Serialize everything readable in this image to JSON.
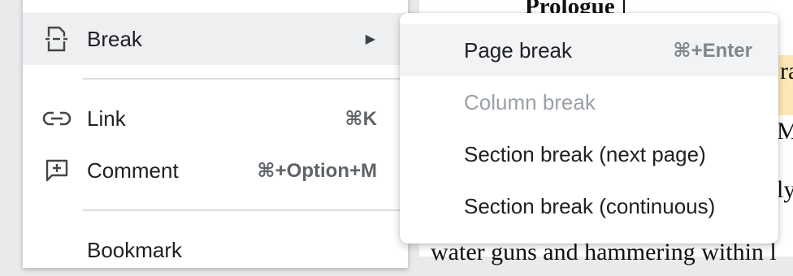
{
  "document": {
    "title": "Prologue",
    "fragments": [
      "ra",
      "M",
      "ly"
    ],
    "bottom_line": "water guns and hammering within l"
  },
  "menu": {
    "items": [
      {
        "label": "Break",
        "icon": "page-break-icon",
        "has_submenu": true,
        "arrow": "▶"
      },
      {
        "label": "Link",
        "icon": "link-icon",
        "shortcut": "⌘K"
      },
      {
        "label": "Comment",
        "icon": "add-comment-icon",
        "shortcut": "⌘+Option+M"
      },
      {
        "label": "Bookmark"
      }
    ]
  },
  "submenu": {
    "items": [
      {
        "label": "Page break",
        "shortcut": "⌘+Enter",
        "state": "hovered"
      },
      {
        "label": "Column break",
        "state": "disabled"
      },
      {
        "label": "Section break (next page)"
      },
      {
        "label": "Section break (continuous)"
      }
    ]
  },
  "colors": {
    "highlight": "#fde7b6",
    "disabled_text": "#9aa0a6",
    "hover_bg": "#eeeff1"
  }
}
